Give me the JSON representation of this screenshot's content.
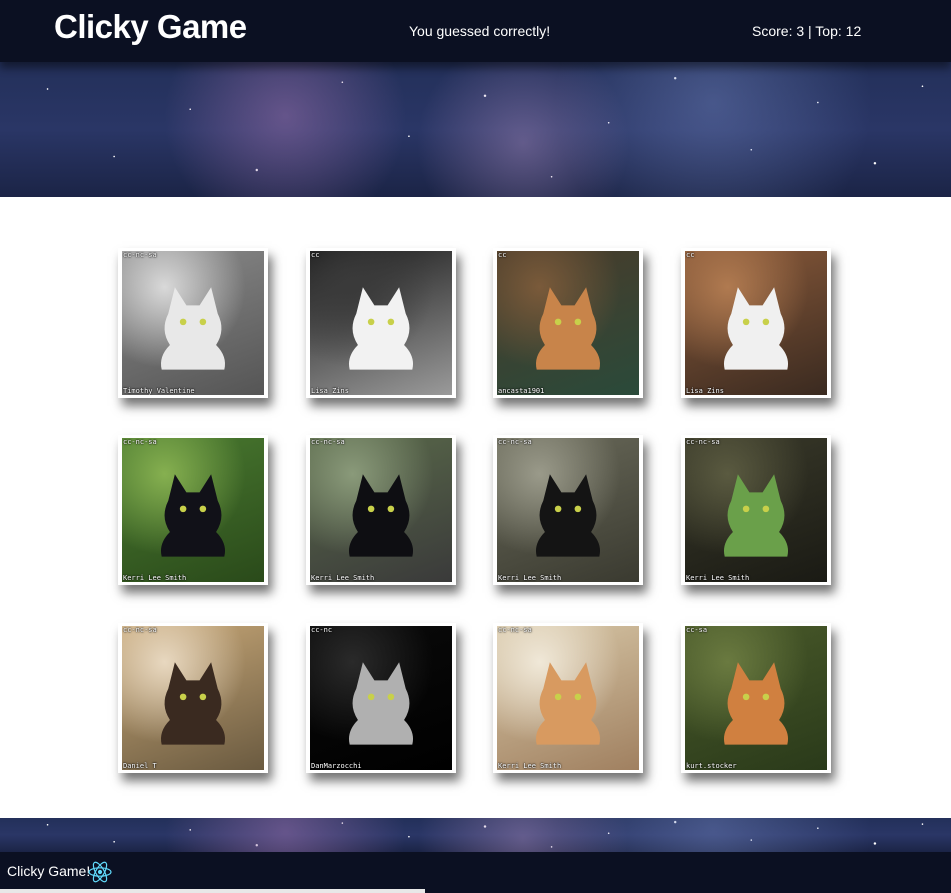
{
  "navbar": {
    "brand": "Clicky Game",
    "message": "You guessed correctly!",
    "score": "Score: 3 | Top: 12"
  },
  "cards": [
    {
      "license": "cc-nc-sa",
      "credit": "Timothy Valentine",
      "colors": [
        "#8a8a8a",
        "#d9d9d9",
        "#555555"
      ],
      "cat_color": "#e8e8e8"
    },
    {
      "license": "cc",
      "credit": "Lisa Zins",
      "colors": [
        "#1a1a1a",
        "#3a3a3a",
        "#9a9a9a"
      ],
      "cat_color": "#f2f2f2"
    },
    {
      "license": "cc",
      "credit": "ancasta1901",
      "colors": [
        "#4a3b2a",
        "#7a5a3a",
        "#2a4a3a"
      ],
      "cat_color": "#c8844a"
    },
    {
      "license": "cc",
      "credit": "Lisa Zins",
      "colors": [
        "#8a5a3a",
        "#b07a50",
        "#3a2a20"
      ],
      "cat_color": "#f0f0f0"
    },
    {
      "license": "cc-nc-sa",
      "credit": "Kerri Lee Smith",
      "colors": [
        "#4a7a30",
        "#86b050",
        "#2a4a1a"
      ],
      "cat_color": "#111118"
    },
    {
      "license": "cc-nc-sa",
      "credit": "Kerri Lee Smith",
      "colors": [
        "#5a6a4a",
        "#8a9a7a",
        "#3a3a3a"
      ],
      "cat_color": "#0e0e12"
    },
    {
      "license": "cc-nc-sa",
      "credit": "Kerri Lee Smith",
      "colors": [
        "#6a6a5a",
        "#9a9a8a",
        "#3a3a30"
      ],
      "cat_color": "#141414"
    },
    {
      "license": "cc-nc-sa",
      "credit": "Kerri Lee Smith",
      "colors": [
        "#3a3a2a",
        "#5a5a40",
        "#1a1a14"
      ],
      "cat_color": "#6aa04a"
    },
    {
      "license": "cc-nc-sa",
      "credit": "Daniel T",
      "colors": [
        "#c8a878",
        "#e8d8c0",
        "#6a5a40"
      ],
      "cat_color": "#3a2a20"
    },
    {
      "license": "cc-nc",
      "credit": "DanMarzocchi",
      "colors": [
        "#0a0a0a",
        "#2a2a2a",
        "#000000"
      ],
      "cat_color": "#b0b0b0"
    },
    {
      "license": "cc-nc-sa",
      "credit": "Kerri Lee Smith",
      "colors": [
        "#d8c8a8",
        "#f0e8d8",
        "#a08060"
      ],
      "cat_color": "#d89a60"
    },
    {
      "license": "cc-sa",
      "credit": "kurt.stocker",
      "colors": [
        "#4a5a2a",
        "#6a7a40",
        "#2a3a1a"
      ],
      "cat_color": "#d08040"
    }
  ],
  "footer": {
    "text": "Clicky Game!",
    "logo_icon": "react-logo-icon",
    "logo_color": "#61dafb"
  }
}
